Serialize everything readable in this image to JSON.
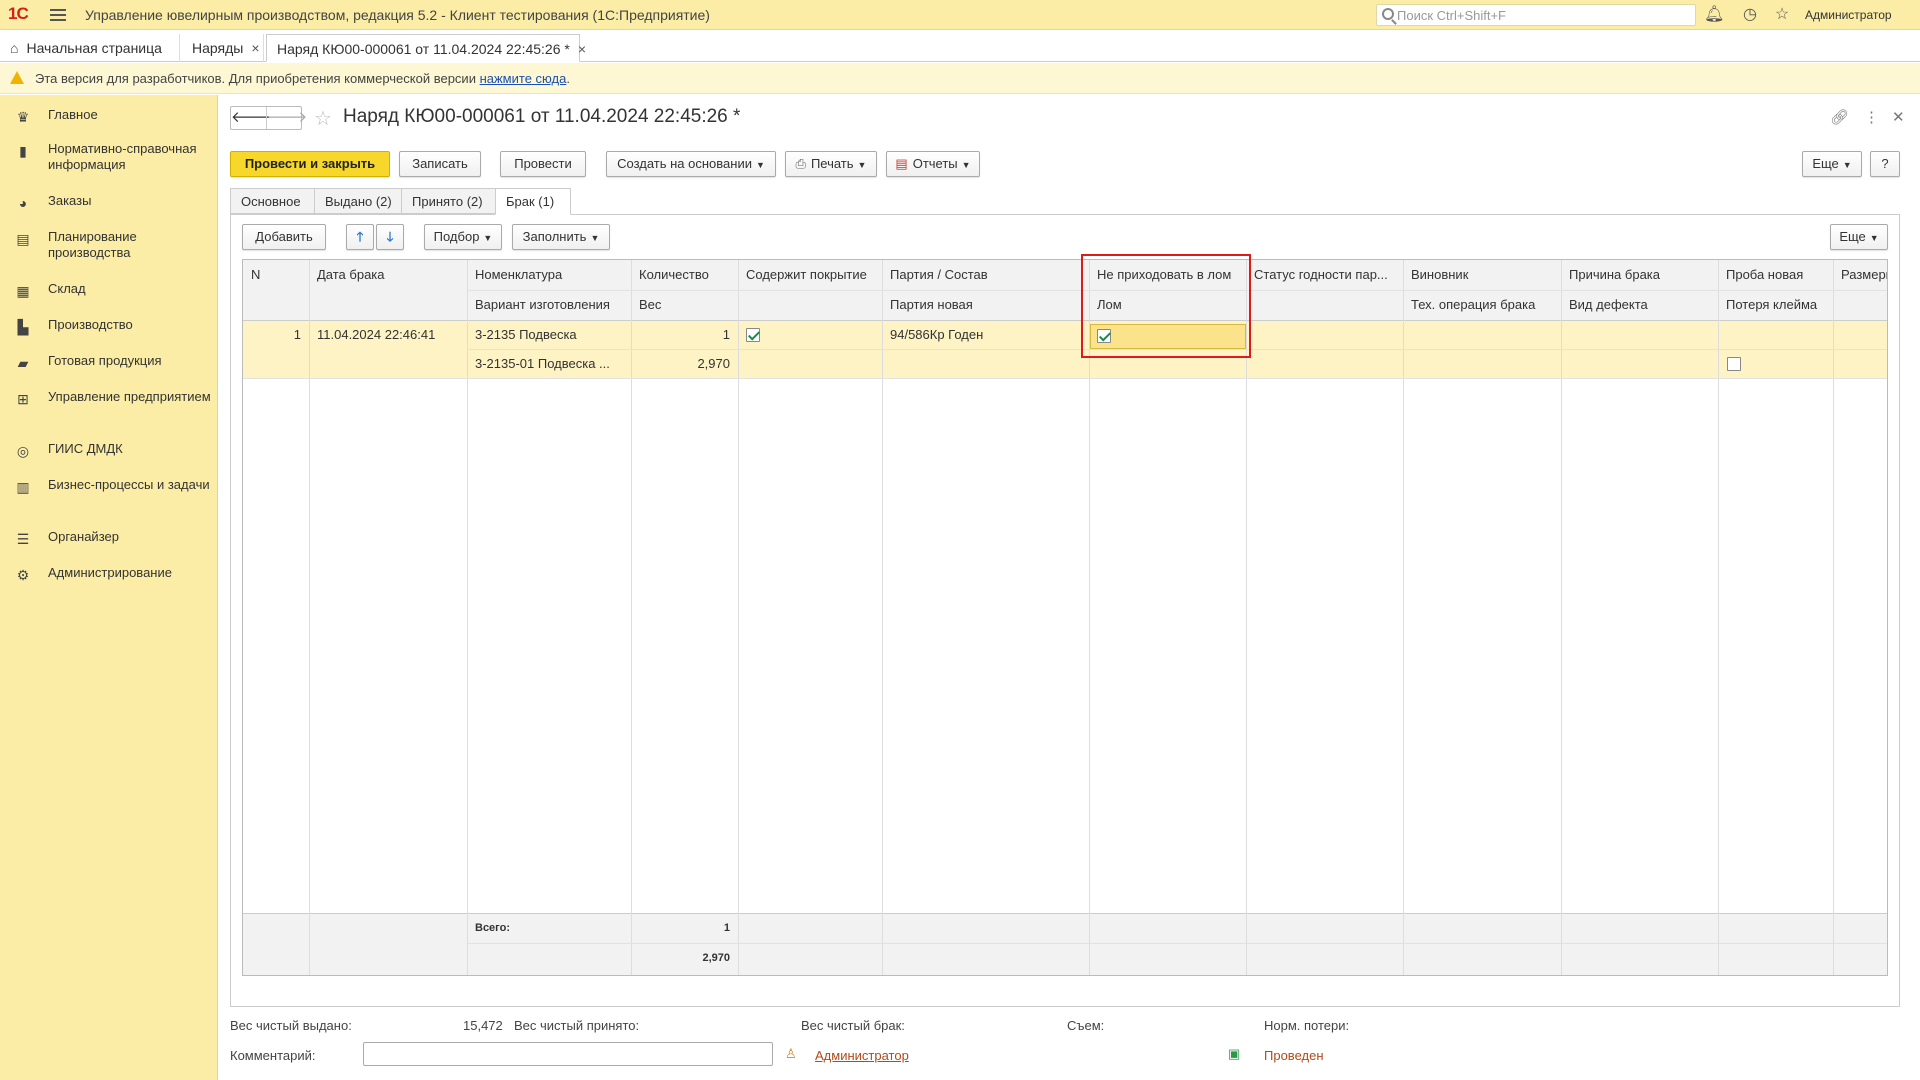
{
  "app": {
    "logo": "1С",
    "title": "Управление ювелирным производством, редакция 5.2  - Клиент тестирования (1С:Предприятие)",
    "search_placeholder": "Поиск Ctrl+Shift+F",
    "user": "Администратор"
  },
  "tabs": [
    {
      "label": "Начальная страница"
    },
    {
      "label": "Наряды"
    },
    {
      "label": "Наряд КЮ00-000061 от 11.04.2024 22:45:26 *"
    }
  ],
  "warning": {
    "text": "Эта версия для разработчиков. Для приобретения коммерческой версии ",
    "link": "нажмите сюда",
    "tail": "."
  },
  "sidebar": {
    "items": [
      {
        "label": "Главное",
        "icon": "crown-icon"
      },
      {
        "label": "Нормативно-справочная информация",
        "icon": "book-icon"
      },
      {
        "label": "Заказы",
        "icon": "pie-icon"
      },
      {
        "label": "Планирование производства",
        "icon": "clipboard-icon"
      },
      {
        "label": "Склад",
        "icon": "grid-icon"
      },
      {
        "label": "Производство",
        "icon": "factory-icon"
      },
      {
        "label": "Готовая продукция",
        "icon": "bag-icon"
      },
      {
        "label": "Управление предприятием",
        "icon": "org-icon"
      },
      {
        "label": "ГИИС ДМДК",
        "icon": "ring-icon"
      },
      {
        "label": "Бизнес-процессы и задачи",
        "icon": "tasks-icon"
      },
      {
        "label": "Органайзер",
        "icon": "organizer-icon"
      },
      {
        "label": "Администрирование",
        "icon": "gear-icon"
      }
    ]
  },
  "form": {
    "title": "Наряд КЮ00-000061 от 11.04.2024 22:45:26 *",
    "buttons": {
      "post_close": "Провести и закрыть",
      "save": "Записать",
      "post": "Провести",
      "create_based": "Создать на основании",
      "print": "Печать",
      "reports": "Отчеты",
      "more": "Еще",
      "help": "?"
    },
    "tabs": [
      {
        "label": "Основное"
      },
      {
        "label": "Выдано (2)"
      },
      {
        "label": "Принято (2)"
      },
      {
        "label": "Брак (1)"
      }
    ],
    "table_toolbar": {
      "add": "Добавить",
      "select": "Подбор",
      "fill": "Заполнить",
      "more": "Еще"
    },
    "columns": {
      "n": "N",
      "date": "Дата брака",
      "nomenclature": "Номенклатура",
      "variant": "Вариант изготовления",
      "quantity": "Количество",
      "weight": "Вес",
      "coating": "Содержит покрытие",
      "batch": "Партия / Состав",
      "batch_new": "Партия новая",
      "no_scrap": "Не приходовать в лом",
      "scrap": "Лом",
      "status": "Статус годности пар...",
      "culprit": "Виновник",
      "tech_op": "Тех. операция брака",
      "reason": "Причина брака",
      "defect": "Вид дефекта",
      "assay": "Проба новая",
      "mark_loss": "Потеря клейма",
      "size": "Размеры"
    },
    "rows": [
      {
        "n": "1",
        "date": "11.04.2024 22:46:41",
        "nomenclature": "3-2135 Подвеска",
        "variant": "3-2135-01 Подвеска ...",
        "quantity": "1",
        "weight": "2,970",
        "coating": true,
        "batch": "94/586Кр Годен",
        "no_scrap": true,
        "mark_loss": false
      }
    ],
    "totals": {
      "label": "Всего:",
      "quantity": "1",
      "weight": "2,970"
    },
    "footer": {
      "net_issued_label": "Вес чистый выдано:",
      "net_issued_value": "15,472",
      "net_received_label": "Вес чистый принято:",
      "net_scrap_label": "Вес чистый брак:",
      "removal_label": "Съем:",
      "norm_loss_label": "Норм. потери:",
      "comment_label": "Комментарий:",
      "author": "Администратор",
      "status": "Проведен"
    }
  },
  "colors": {
    "accent": "#f7d72a",
    "sidebar": "#fbeda5",
    "highlight_box": "#e01a1a"
  }
}
